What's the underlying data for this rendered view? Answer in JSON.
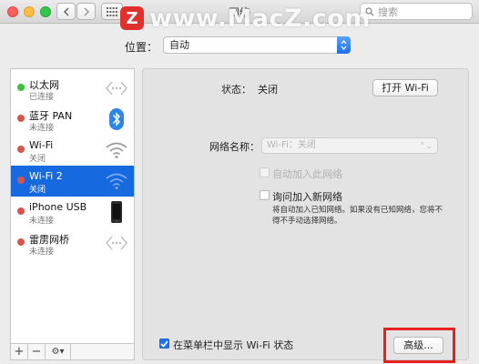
{
  "window": {
    "title": "网络",
    "search_placeholder": "搜索",
    "nav_back_icon": "chevron-left-icon",
    "nav_forward_icon": "chevron-right-icon",
    "grid_icon": "grid-icon"
  },
  "watermark": {
    "logo_letter": "Z",
    "text": "www.MacZ.com"
  },
  "location": {
    "label": "位置：",
    "value": "自动"
  },
  "services": [
    {
      "name": "以太网",
      "status": "已连接",
      "dot": "#3fbf3a",
      "icon": "ethernet-icon"
    },
    {
      "name": "蓝牙 PAN",
      "status": "未连接",
      "dot": "#d9534f",
      "icon": "bluetooth-icon"
    },
    {
      "name": "Wi-Fi",
      "status": "关闭",
      "dot": "#d9534f",
      "icon": "wifi-icon"
    },
    {
      "name": "Wi-Fi 2",
      "status": "关闭",
      "dot": "#d9534f",
      "icon": "wifi-icon"
    },
    {
      "name": "iPhone USB",
      "status": "未连接",
      "dot": "#d9534f",
      "icon": "iphone-icon"
    },
    {
      "name": "雷雳网桥",
      "status": "未连接",
      "dot": "#d9534f",
      "icon": "thunderbolt-bridge-icon"
    }
  ],
  "selected_index": 3,
  "sidebar_buttons": {
    "add": "+",
    "remove": "−",
    "gear": "⚙▾"
  },
  "detail": {
    "status_label": "状态：",
    "status_value": "关闭",
    "toggle_wifi_button": "打开 Wi-Fi",
    "network_name_label": "网络名称：",
    "network_name_placeholder": "Wi-Fi：关闭",
    "auto_join_label": "自动加入此网络",
    "ask_join_label": "询问加入新网络",
    "ask_join_note": "将自动加入已知网络。如果没有已知网络，您将不得不手动选择网络。",
    "show_in_menubar_label": "在菜单栏中显示 Wi-Fi 状态",
    "show_in_menubar_checked": true,
    "advanced_button": "高级..."
  },
  "colors": {
    "selection": "#1769e0",
    "highlight_box": "#e5201e",
    "accent": "#1e74e8"
  }
}
